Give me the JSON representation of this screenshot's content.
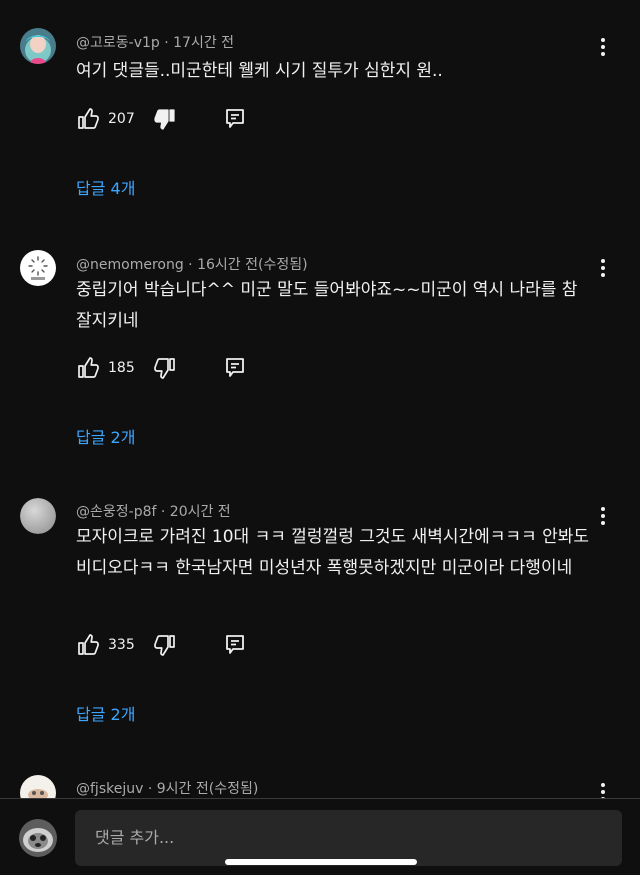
{
  "comments": [
    {
      "author": "@고로동-v1p",
      "time": "17시간 전",
      "text": "여기 댓글들..미군한테 웰케 시기 질투가 심한지 원..",
      "likes": "207",
      "replies": "답글 4개",
      "disliked": true
    },
    {
      "author": "@nemomerong",
      "time": "16시간 전(수정됨)",
      "text": "중립기어 박습니다^^ 미군 말도 들어봐야죠~~미군이 역시 나라를 참 잘지키네",
      "likes": "185",
      "replies": "답글 2개",
      "disliked": false
    },
    {
      "author": "@손웅정-p8f",
      "time": "20시간 전",
      "text": "모자이크로 가려진 10대 ㅋㅋ 껄렁껄렁 그것도 새벽시간에ㅋㅋㅋ 안봐도비디오다ㅋㅋ 한국남자면 미성년자 폭행못하겠지만 미군이라 다행이네",
      "likes": "335",
      "replies": "답글 2개",
      "disliked": false
    },
    {
      "author": "@fjskejuv",
      "time": "9시간 전(수정됨)"
    }
  ],
  "separator": " · ",
  "add_comment_placeholder": "댓글 추가...",
  "icons": {
    "like": "thumbs-up-icon",
    "dislike": "thumbs-down-icon",
    "reply": "reply-icon",
    "more": "more-vert-icon"
  },
  "colors": {
    "background": "#0f0f0f",
    "text": "#f1f1f1",
    "secondary_text": "#aaaaaa",
    "link": "#3ea6ff",
    "input_bg": "#272727"
  }
}
